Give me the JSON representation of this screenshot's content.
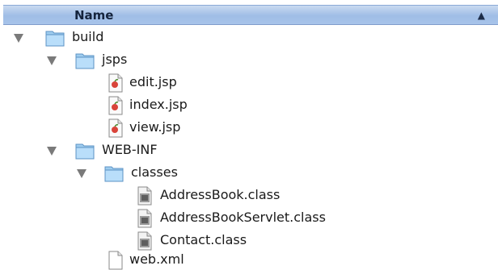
{
  "header": {
    "column_name": "Name",
    "sort_indicator": "▲"
  },
  "tree": [
    {
      "label": "build",
      "icon": "folder-icon",
      "expanded": true
    },
    {
      "label": "jsps",
      "icon": "folder-icon",
      "expanded": true
    },
    {
      "label": "edit.jsp",
      "icon": "jsp-file-icon"
    },
    {
      "label": "index.jsp",
      "icon": "jsp-file-icon"
    },
    {
      "label": "view.jsp",
      "icon": "jsp-file-icon"
    },
    {
      "label": "WEB-INF",
      "icon": "folder-icon",
      "expanded": true
    },
    {
      "label": "classes",
      "icon": "folder-icon",
      "expanded": true
    },
    {
      "label": "AddressBook.class",
      "icon": "class-file-icon"
    },
    {
      "label": "AddressBookServlet.class",
      "icon": "class-file-icon"
    },
    {
      "label": "Contact.class",
      "icon": "class-file-icon"
    },
    {
      "label": "web.xml",
      "icon": "document-icon"
    }
  ],
  "colors": {
    "header_top": "#c9daf0",
    "header_bottom": "#9fbde6",
    "folder": "#a8d2f0",
    "triangle": "#7a7a7a"
  }
}
